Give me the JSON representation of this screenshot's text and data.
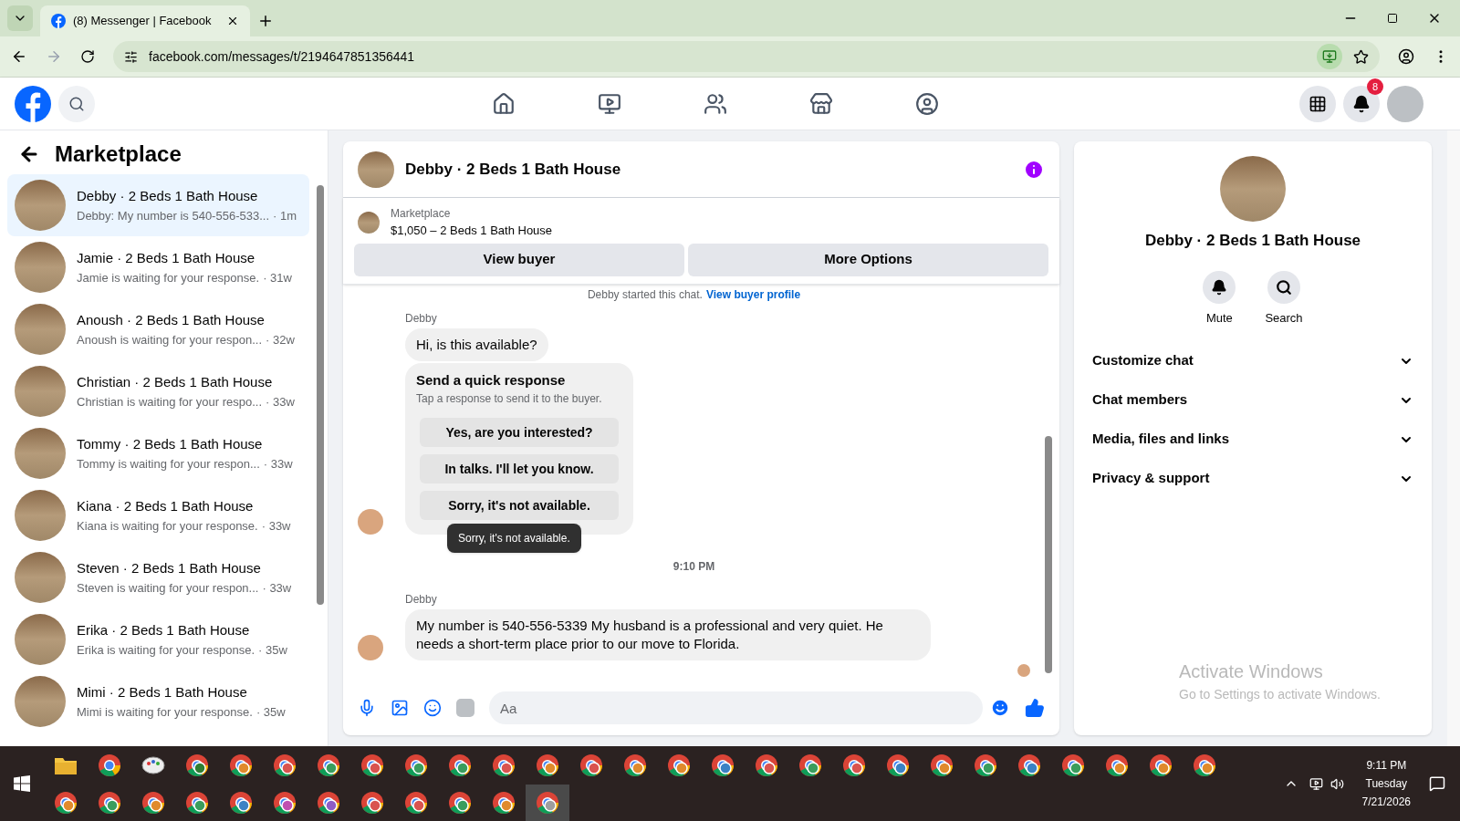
{
  "browser": {
    "tab_title": "(8) Messenger | Facebook",
    "url": "facebook.com/messages/t/2194647851356441"
  },
  "header": {
    "notification_count": "8"
  },
  "sidebar": {
    "title": "Marketplace",
    "chats": [
      {
        "name": "Debby · 2 Beds 1 Bath House",
        "preview": "Debby: My number is 540-556-533...",
        "time": "· 1m",
        "selected": true
      },
      {
        "name": "Jamie · 2 Beds 1 Bath House",
        "preview": "Jamie is waiting for your response.",
        "time": "· 31w",
        "selected": false
      },
      {
        "name": "Anoush · 2 Beds 1 Bath House",
        "preview": "Anoush is waiting for your respon...",
        "time": "· 32w",
        "selected": false
      },
      {
        "name": "Christian · 2 Beds 1 Bath House",
        "preview": "Christian is waiting for your respo...",
        "time": "· 33w",
        "selected": false
      },
      {
        "name": "Tommy · 2 Beds 1 Bath House",
        "preview": "Tommy is waiting for your respon...",
        "time": "· 33w",
        "selected": false
      },
      {
        "name": "Kiana · 2 Beds 1 Bath House",
        "preview": "Kiana is waiting for your response.",
        "time": "· 33w",
        "selected": false
      },
      {
        "name": "Steven · 2 Beds 1 Bath House",
        "preview": "Steven is waiting for your respon...",
        "time": "· 33w",
        "selected": false
      },
      {
        "name": "Erika · 2 Beds 1 Bath House",
        "preview": "Erika is waiting for your response.",
        "time": "· 35w",
        "selected": false
      },
      {
        "name": "Mimi · 2 Beds 1 Bath House",
        "preview": "Mimi is waiting for your response.",
        "time": "· 35w",
        "selected": false
      }
    ]
  },
  "conversation": {
    "title": "Debby · 2 Beds 1 Bath House",
    "listing": {
      "label": "Marketplace",
      "title": "$1,050 – 2 Beds 1 Bath House"
    },
    "buttons": [
      "View buyer",
      "More Options"
    ],
    "started_note": "Debby started this chat.",
    "started_link": "View buyer profile",
    "messages": [
      {
        "kind": "text",
        "sender": "Debby",
        "text": "Hi, is this available?",
        "show_avatar": false
      },
      {
        "kind": "quick_response",
        "title": "Send a quick response",
        "subtitle": "Tap a response to send it to the buyer.",
        "options": [
          "Yes, are you interested?",
          "In talks. I'll let you know.",
          "Sorry, it's not available."
        ],
        "tooltip": "Sorry, it's not available.",
        "show_avatar": true
      },
      {
        "kind": "time",
        "text": "9:10 PM"
      },
      {
        "kind": "text",
        "sender": "Debby",
        "text": "My number is 540-556-5339 My husband is a professional and very quiet. He needs a short-term place prior to our move to Florida.",
        "show_avatar": true
      }
    ],
    "composer": {
      "placeholder": "Aa"
    }
  },
  "details": {
    "title": "Debby · 2 Beds 1 Bath House",
    "actions": [
      {
        "kind": "mute",
        "label": "Mute"
      },
      {
        "kind": "search",
        "label": "Search"
      }
    ],
    "sections": [
      {
        "label": "Customize chat",
        "expanded": false
      },
      {
        "label": "Chat members",
        "expanded": false
      },
      {
        "label": "Media, files and links",
        "expanded": false
      },
      {
        "label": "Privacy & support",
        "expanded": false
      }
    ]
  },
  "activation": {
    "title": "Activate Windows",
    "text": "Go to Settings to activate Windows."
  },
  "taskbar": {
    "time": "9:11 PM",
    "day": "Tuesday",
    "date": "7/21/2026",
    "rows": [
      [
        {
          "kind": "folder",
          "selected": false
        },
        {
          "kind": "chrome",
          "selected": false
        },
        {
          "kind": "paint",
          "selected": false
        },
        {
          "kind": "profile",
          "color": "#2e7d32",
          "selected": false
        },
        {
          "kind": "profile",
          "color": "#e08a2c",
          "selected": false
        },
        {
          "kind": "profile",
          "color": "#d9534f",
          "selected": false
        },
        {
          "kind": "profile",
          "color": "#3a9d5d",
          "selected": false
        },
        {
          "kind": "profile",
          "color": "#d9534f",
          "selected": false
        },
        {
          "kind": "profile",
          "color": "#3a9d5d",
          "selected": false
        },
        {
          "kind": "profile",
          "color": "#3a9d5d",
          "selected": false
        },
        {
          "kind": "profile",
          "color": "#d9534f",
          "selected": false
        },
        {
          "kind": "profile",
          "color": "#e08a2c",
          "selected": false
        },
        {
          "kind": "profile",
          "color": "#d9534f",
          "selected": false
        },
        {
          "kind": "profile",
          "color": "#e08a2c",
          "selected": false
        },
        {
          "kind": "profile",
          "color": "#e08a2c",
          "selected": false
        },
        {
          "kind": "profile",
          "color": "#3b82c4",
          "selected": false
        },
        {
          "kind": "profile",
          "color": "#d9534f",
          "selected": false
        },
        {
          "kind": "profile",
          "color": "#3a9d5d",
          "selected": false
        },
        {
          "kind": "profile",
          "color": "#d9534f",
          "selected": false
        },
        {
          "kind": "profile",
          "color": "#3b82c4",
          "selected": false
        },
        {
          "kind": "profile",
          "color": "#e08a2c",
          "selected": false
        },
        {
          "kind": "profile",
          "color": "#3a9d5d",
          "selected": false
        },
        {
          "kind": "profile",
          "color": "#3b82c4",
          "selected": false
        },
        {
          "kind": "profile",
          "color": "#3a9d5d",
          "selected": false
        },
        {
          "kind": "profile",
          "color": "#e08a2c",
          "selected": false
        },
        {
          "kind": "profile",
          "color": "#e08a2c",
          "selected": false
        },
        {
          "kind": "profile",
          "color": "#e08a2c",
          "selected": false
        }
      ],
      [
        {
          "kind": "profile",
          "color": "#e08a2c",
          "selected": false
        },
        {
          "kind": "profile",
          "color": "#3a9d5d",
          "selected": false
        },
        {
          "kind": "profile",
          "color": "#e08a2c",
          "selected": false
        },
        {
          "kind": "profile",
          "color": "#3a9d5d",
          "selected": false
        },
        {
          "kind": "profile",
          "color": "#3b82c4",
          "selected": false
        },
        {
          "kind": "profile",
          "color": "#c04fb0",
          "selected": false
        },
        {
          "kind": "profile",
          "color": "#8e5cc4",
          "selected": false
        },
        {
          "kind": "profile",
          "color": "#d9534f",
          "selected": false
        },
        {
          "kind": "profile",
          "color": "#d9534f",
          "selected": false
        },
        {
          "kind": "profile",
          "color": "#3a9d5d",
          "selected": false
        },
        {
          "kind": "profile",
          "color": "#e08a2c",
          "selected": false
        },
        {
          "kind": "profile",
          "color": "#9e9e9e",
          "selected": true
        }
      ]
    ]
  }
}
